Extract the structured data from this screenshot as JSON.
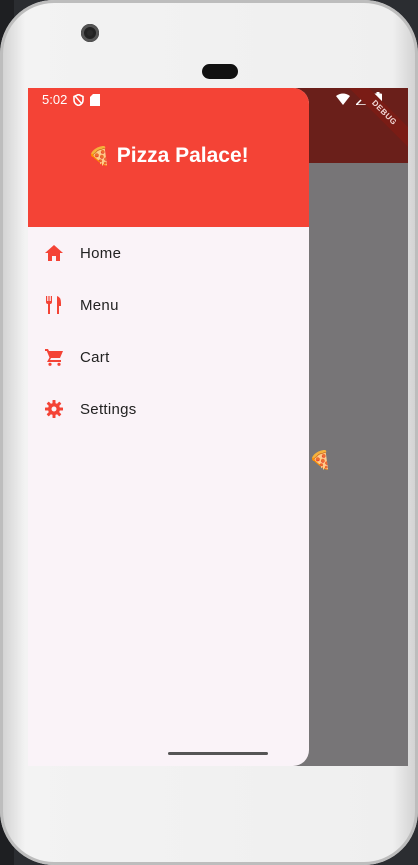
{
  "status_bar": {
    "time": "5:02"
  },
  "drawer": {
    "title": "Pizza Palace!",
    "title_emoji": "🍕",
    "items": [
      {
        "label": "Home",
        "icon": "home-icon"
      },
      {
        "label": "Menu",
        "icon": "restaurant-icon"
      },
      {
        "label": "Cart",
        "icon": "cart-icon"
      },
      {
        "label": "Settings",
        "icon": "gear-icon"
      }
    ]
  },
  "background": {
    "partial_text": "! 🍕"
  },
  "debug_banner": "DEBUG",
  "colors": {
    "accent": "#f44336",
    "drawer_bg": "#faf3f8",
    "scrim": "#777577"
  }
}
